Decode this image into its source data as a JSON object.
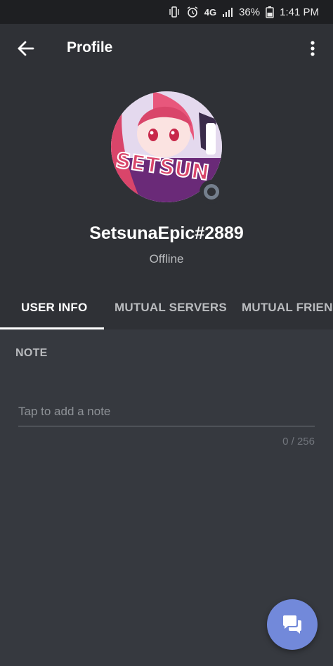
{
  "status_bar": {
    "battery": "36%",
    "time": "1:41 PM",
    "network": "4G",
    "icons": [
      "vibrate-icon",
      "alarm-icon",
      "lte-icon",
      "signal-icon",
      "battery-icon"
    ]
  },
  "appbar": {
    "title": "Profile",
    "back_icon": "arrow-left-icon",
    "menu_icon": "more-vertical-icon"
  },
  "profile": {
    "username": "SetsunaEpic#2889",
    "status": "Offline",
    "status_color": "#747f8d",
    "avatar_text": "SETSUN"
  },
  "tabs": [
    {
      "label": "USER INFO",
      "active": true
    },
    {
      "label": "MUTUAL SERVERS",
      "active": false
    },
    {
      "label": "MUTUAL FRIENDS",
      "active": false
    }
  ],
  "note": {
    "label": "NOTE",
    "placeholder": "Tap to add a note",
    "value": "",
    "char_count": "0 / 256"
  },
  "fab": {
    "icon": "chat-bubbles-icon",
    "color": "#7289da"
  },
  "colors": {
    "background": "#36393f",
    "header": "#2f3136",
    "accent": "#7289da"
  }
}
